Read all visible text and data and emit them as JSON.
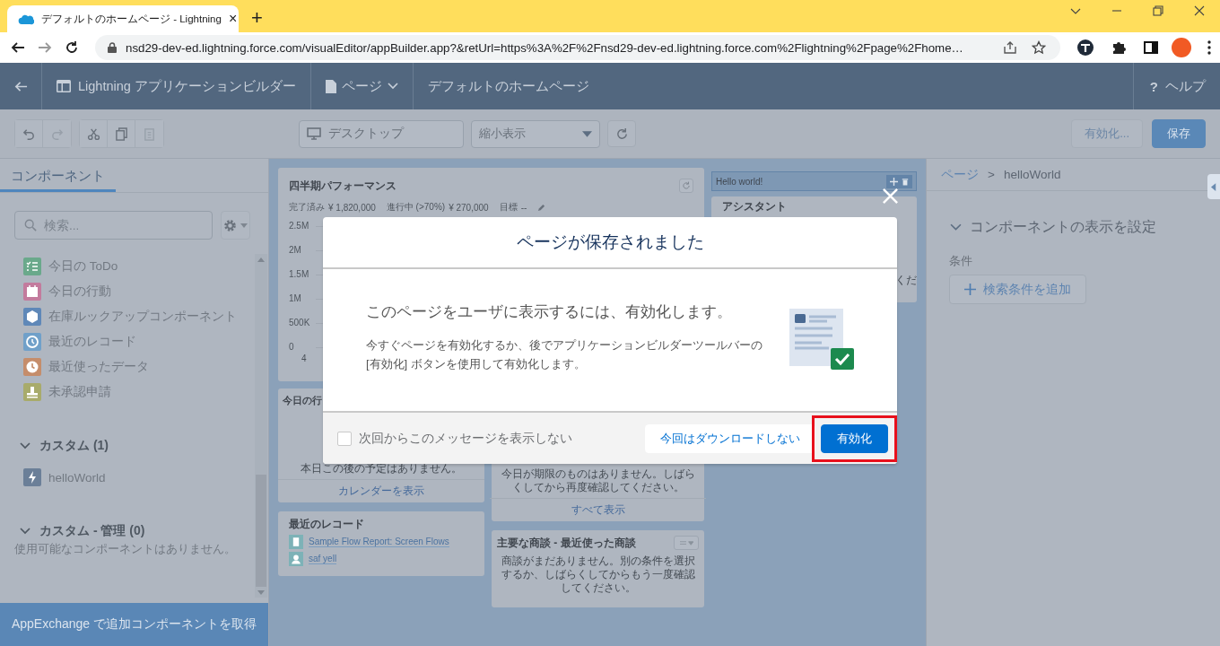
{
  "browser": {
    "tab": {
      "title": "デフォルトのホームページ - Lightning",
      "close": "×"
    },
    "new_tab": "+",
    "forward_disabled": true,
    "url": "nsd29-dev-ed.lightning.force.com/visualEditor/appBuilder.app?&retUrl=https%3A%2F%2Fnsd29-dev-ed.lightning.force.com%2Flightning%2Fpage%2Fhome…"
  },
  "app_header": {
    "app_name": "Lightning アプリケーションビルダー",
    "page_menu": "ページ",
    "page_title": "デフォルトのホームページ",
    "help_icon": "?",
    "help": "ヘルプ"
  },
  "toolbar": {
    "edit_buttons": [
      {
        "kind": "undo",
        "disabled": false
      },
      {
        "kind": "redo",
        "disabled": true
      },
      {
        "kind": "cut",
        "disabled": false
      },
      {
        "kind": "copy",
        "disabled": false
      },
      {
        "kind": "paste",
        "disabled": true
      }
    ],
    "device": "デスクトップ",
    "zoom": "縮小表示",
    "activate": "有効化...",
    "save": "保存"
  },
  "left_panel": {
    "tabs": [
      {
        "label": "コンポーネント",
        "selected": true
      }
    ],
    "search": {
      "placeholder": "検索..."
    },
    "components": [
      {
        "kind": "todo",
        "label": "今日の ToDo",
        "color": "#6aa98b"
      },
      {
        "kind": "event",
        "label": "今日の行動",
        "color": "#c37b9d"
      },
      {
        "kind": "cube",
        "label": "在庫ルックアップコンポーネント",
        "color": "#5f88b8"
      },
      {
        "kind": "recent",
        "label": "最近のレコード",
        "color": "#70a0c9"
      },
      {
        "kind": "clock",
        "label": "最近使ったデータ",
        "color": "#c58d6b"
      },
      {
        "kind": "approval",
        "label": "未承認申請",
        "color": "#a8ab6b"
      }
    ],
    "sections": [
      {
        "title": "カスタム (1)",
        "expanded": true,
        "items": [
          {
            "label": "helloWorld",
            "color": "#6b7f98"
          }
        ]
      },
      {
        "title": "カスタム - 管理 (0)",
        "expanded": true,
        "empty_message": "使用可能なコンポーネントはありません。"
      }
    ],
    "footer": "AppExchange で追加コンポーネントを取得"
  },
  "canvas": {
    "performance": {
      "title": "四半期パフォーマンス",
      "stats": [
        {
          "label": "完了済み",
          "value": "¥ 1,820,000"
        },
        {
          "label": "進行中 (>70%)",
          "value": "¥ 270,000"
        },
        {
          "label": "目標",
          "value": "--"
        }
      ],
      "y_labels": [
        "2.5M",
        "2M",
        "1.5M",
        "1M",
        "500K",
        "0"
      ],
      "x_label": "4"
    },
    "hello": {
      "text": "Hello world!"
    },
    "assistant": {
      "title": "アシスタント",
      "text": "くだ"
    },
    "events": {
      "title": "今日の行",
      "message": "本日この後の予定はありません。",
      "link": "カレンダーを表示"
    },
    "recent_records": {
      "title": "最近のレコード",
      "items": [
        {
          "kind": "report",
          "label": "Sample Flow Report: Screen Flows"
        },
        {
          "kind": "user",
          "label": "saf yell"
        }
      ]
    },
    "tasks": {
      "message": "今日が期限のものはありません。しばらくしてから再度確認してください。",
      "link": "すべて表示"
    },
    "opportunities": {
      "title": "主要な商談 - 最近使った商談",
      "message": "商談がまだありません。別の条件を選択するか、しばらくしてからもう一度確認してください。"
    }
  },
  "right_panel": {
    "breadcrumb": [
      "ページ",
      "helloWorld"
    ],
    "separator": ">",
    "section": {
      "title": "コンポーネントの表示を設定",
      "expanded": true
    },
    "conditions_label": "条件",
    "add_filter": "検索条件を追加"
  },
  "modal": {
    "title": "ページが保存されました",
    "heading": "このページをユーザに表示するには、有効化します。",
    "body": "今すぐページを有効化するか、後でアプリケーションビルダーツールバーの [有効化] ボタンを使用して有効化します。",
    "dont_show": {
      "label": "次回からこのメッセージを表示しない",
      "checked": false
    },
    "buttons": [
      {
        "kind": "neutral",
        "label": "今回はダウンロードしない",
        "highlighted": false
      },
      {
        "kind": "brand",
        "label": "有効化",
        "highlighted": true
      }
    ]
  }
}
